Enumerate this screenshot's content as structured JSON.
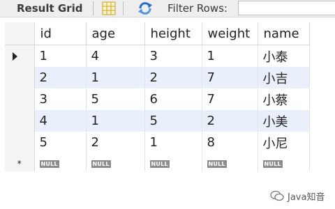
{
  "toolbar": {
    "title": "Result Grid",
    "filter_label": "Filter Rows:",
    "filter_value": ""
  },
  "grid": {
    "columns": [
      "id",
      "age",
      "height",
      "weight",
      "name"
    ],
    "rows": [
      [
        "1",
        "4",
        "3",
        "1",
        "小泰"
      ],
      [
        "2",
        "1",
        "2",
        "7",
        "小吉"
      ],
      [
        "3",
        "5",
        "6",
        "7",
        "小蔡"
      ],
      [
        "4",
        "1",
        "5",
        "2",
        "小美"
      ],
      [
        "5",
        "2",
        "1",
        "8",
        "小尼"
      ]
    ],
    "null_label": "NULL",
    "new_row_marker": "*"
  },
  "watermark": {
    "text": "Java知音"
  },
  "colors": {
    "row_stripe": "#eaf0fb",
    "toolbar_bg": "#eeeeee",
    "refresh_icon": "#2a6fc7"
  }
}
